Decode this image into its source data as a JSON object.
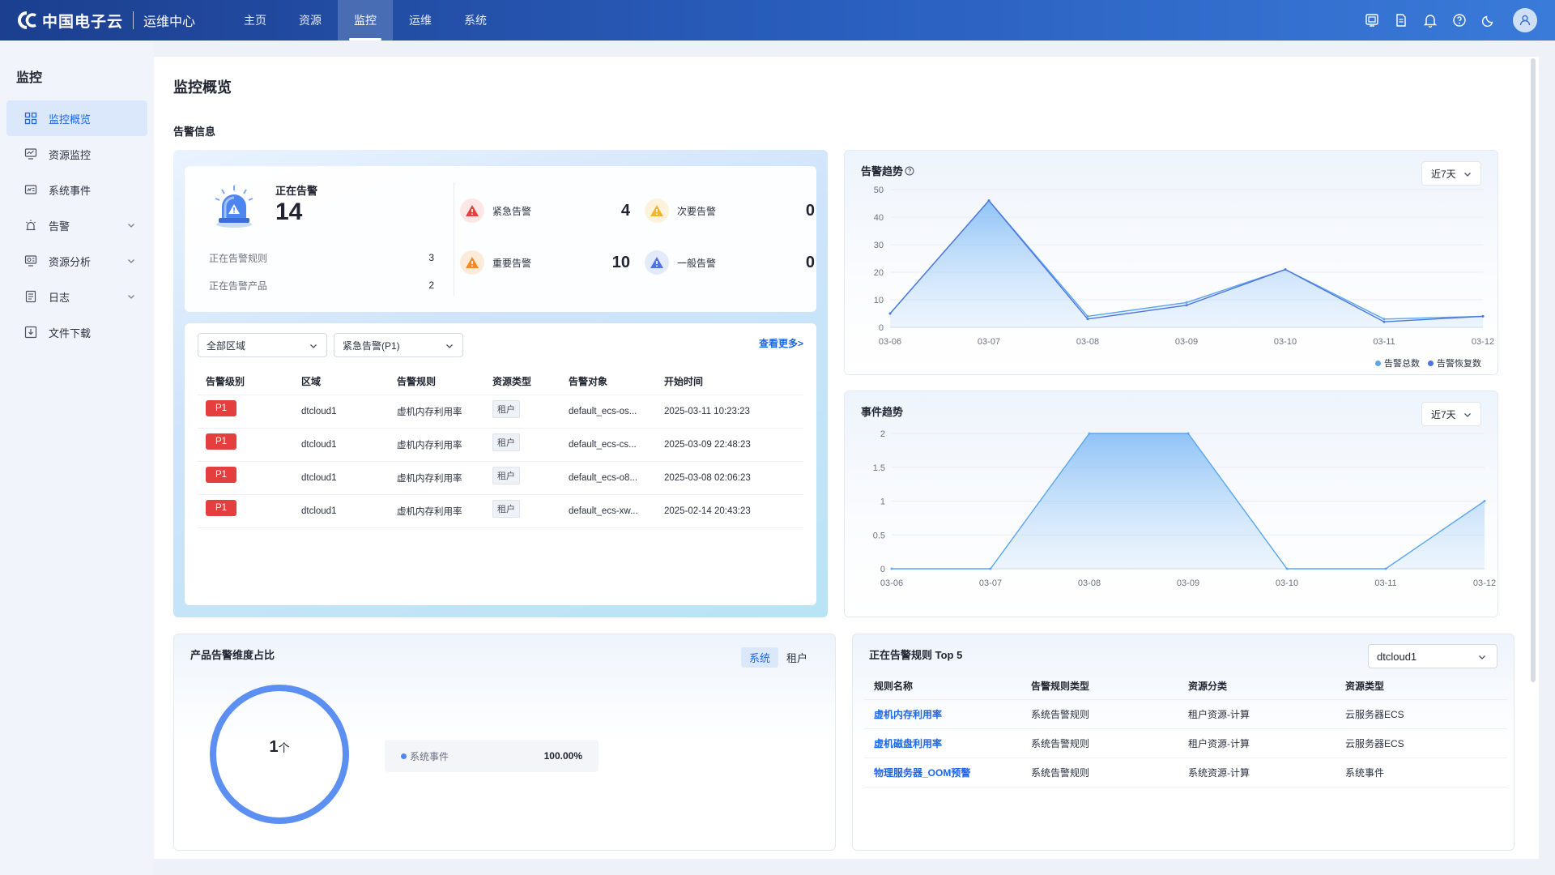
{
  "app": {
    "logo_text": "中国电子云",
    "subtitle": "运维中心",
    "nav": [
      {
        "label": "主页"
      },
      {
        "label": "资源"
      },
      {
        "label": "监控"
      },
      {
        "label": "运维"
      },
      {
        "label": "系统"
      }
    ],
    "active_nav": "监控"
  },
  "sidebar": {
    "title": "监控",
    "items": [
      {
        "label": "监控概览",
        "icon": "grid-icon",
        "active": true
      },
      {
        "label": "资源监控",
        "icon": "monitor-icon"
      },
      {
        "label": "系统事件",
        "icon": "event-icon"
      },
      {
        "label": "告警",
        "icon": "alarm-icon",
        "expandable": true
      },
      {
        "label": "资源分析",
        "icon": "analysis-icon",
        "expandable": true
      },
      {
        "label": "日志",
        "icon": "log-icon",
        "expandable": true
      },
      {
        "label": "文件下载",
        "icon": "download-icon"
      }
    ]
  },
  "page": {
    "title": "监控概览",
    "section_alarm": "告警信息"
  },
  "alarm_summary": {
    "label": "正在告警",
    "count": "14",
    "rules_label": "正在告警规则",
    "rules_count": "3",
    "products_label": "正在告警产品",
    "products_count": "2",
    "severities": [
      {
        "label": "紧急告警",
        "count": "4",
        "color": "#e53e3e"
      },
      {
        "label": "次要告警",
        "count": "0",
        "color": "#f2b530"
      },
      {
        "label": "重要告警",
        "count": "10",
        "color": "#f08a2c"
      },
      {
        "label": "一般告警",
        "count": "0",
        "color": "#4e74e0"
      }
    ]
  },
  "alarm_list": {
    "region_filter": "全部区域",
    "level_filter": "紧急告警(P1)",
    "more_label": "查看更多>",
    "columns": [
      "告警级别",
      "区域",
      "告警规则",
      "资源类型",
      "告警对象",
      "开始时间"
    ],
    "rows": [
      {
        "level": "P1",
        "region": "dtcloud1",
        "rule": "虚机内存利用率",
        "type": "租户",
        "target": "default_ecs-os...",
        "time": "2025-03-11 10:23:23"
      },
      {
        "level": "P1",
        "region": "dtcloud1",
        "rule": "虚机内存利用率",
        "type": "租户",
        "target": "default_ecs-cs...",
        "time": "2025-03-09 22:48:23"
      },
      {
        "level": "P1",
        "region": "dtcloud1",
        "rule": "虚机内存利用率",
        "type": "租户",
        "target": "default_ecs-o8...",
        "time": "2025-03-08 02:06:23"
      },
      {
        "level": "P1",
        "region": "dtcloud1",
        "rule": "虚机内存利用率",
        "type": "租户",
        "target": "default_ecs-xw...",
        "time": "2025-02-14 20:43:23"
      }
    ]
  },
  "alarm_trend": {
    "title": "告警趋势",
    "range": "近7天",
    "legend": [
      "告警总数",
      "告警恢复数"
    ]
  },
  "event_trend": {
    "title": "事件趋势",
    "range": "近7天"
  },
  "chart_data": [
    {
      "type": "area",
      "title": "告警趋势",
      "x": [
        "03-06",
        "03-07",
        "03-08",
        "03-09",
        "03-10",
        "03-11",
        "03-12"
      ],
      "yticks": [
        "0",
        "10",
        "20",
        "30",
        "40",
        "50"
      ],
      "ylim": [
        0,
        50
      ],
      "series": [
        {
          "name": "告警总数",
          "values": [
            5,
            46,
            4,
            9,
            21,
            3,
            4
          ],
          "color": "#5aa6ef"
        },
        {
          "name": "告警恢复数",
          "values": [
            5,
            46,
            3,
            8,
            21,
            2,
            4
          ],
          "color": "#4e74e0"
        }
      ],
      "grid": true,
      "legend_position": "bottom-right"
    },
    {
      "type": "area",
      "title": "事件趋势",
      "x": [
        "03-06",
        "03-07",
        "03-08",
        "03-09",
        "03-10",
        "03-11",
        "03-12"
      ],
      "yticks": [
        "0",
        "0.5",
        "1",
        "1.5",
        "2"
      ],
      "ylim": [
        0,
        2
      ],
      "series": [
        {
          "values": [
            0,
            0,
            2,
            2,
            0,
            0,
            1
          ],
          "color": "#5aa6ef"
        }
      ],
      "grid": true
    }
  ],
  "product_ratio": {
    "title": "产品告警维度占比",
    "tabs": [
      "系统",
      "租户"
    ],
    "active_tab": "系统",
    "center_value": "1",
    "center_unit": "个",
    "items": [
      {
        "label": "系统事件",
        "percent": "100.00%",
        "color": "#4e86f0"
      }
    ]
  },
  "top_rules": {
    "title": "正在告警规则 Top 5",
    "region": "dtcloud1",
    "columns": [
      "规则名称",
      "告警规则类型",
      "资源分类",
      "资源类型"
    ],
    "rows": [
      {
        "name": "虚机内存利用率",
        "rule_type": "系统告警规则",
        "category": "租户资源-计算",
        "resource": "云服务器ECS"
      },
      {
        "name": "虚机磁盘利用率",
        "rule_type": "系统告警规则",
        "category": "租户资源-计算",
        "resource": "云服务器ECS"
      },
      {
        "name": "物理服务器_OOM预警",
        "rule_type": "系统告警规则",
        "category": "系统资源-计算",
        "resource": "系统事件"
      }
    ]
  }
}
